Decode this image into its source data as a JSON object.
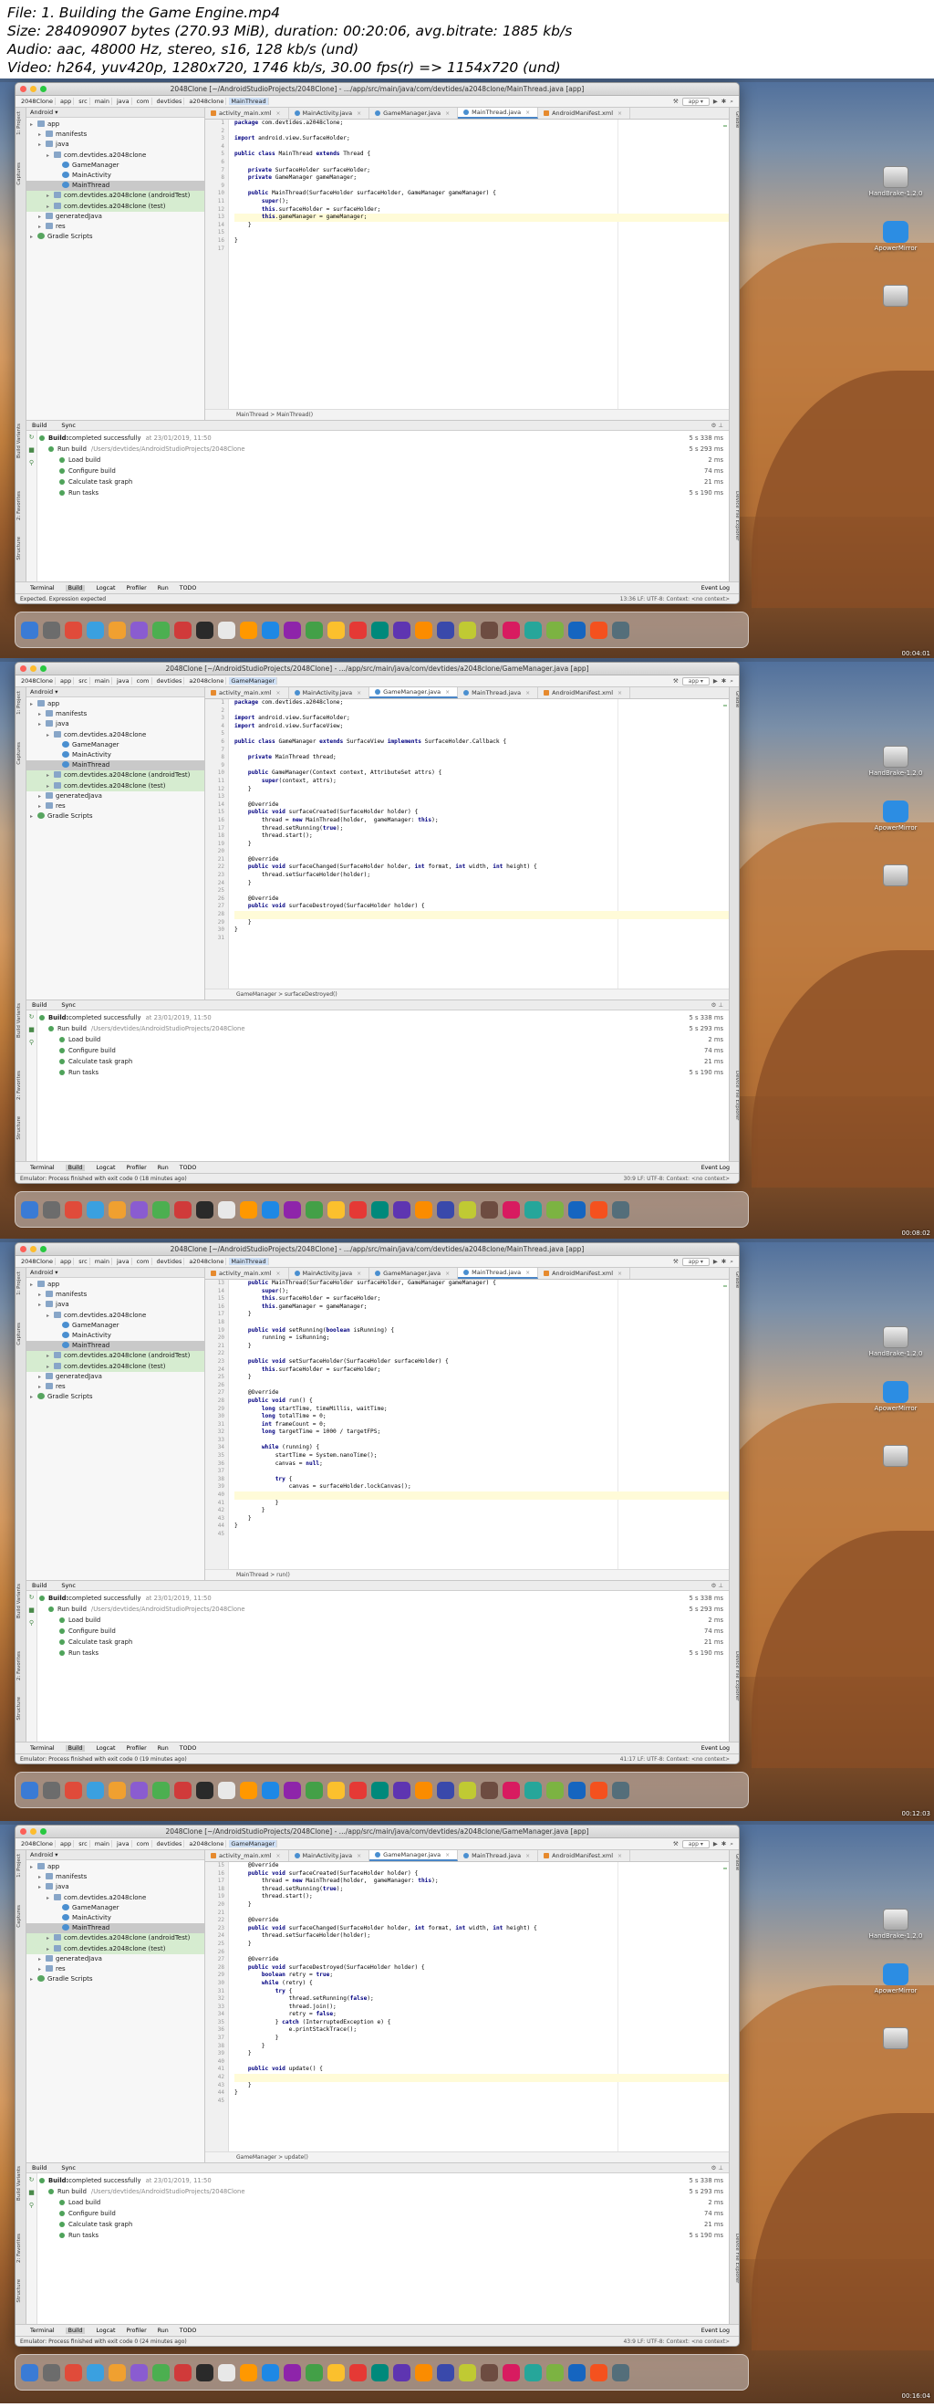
{
  "file_info": {
    "file": "File: 1. Building the Game Engine.mp4",
    "size": "Size: 284090907 bytes (270.93 MiB), duration: 00:20:06, avg.bitrate: 1885 kb/s",
    "audio": "Audio: aac, 48000 Hz, stereo, s16, 128 kb/s (und)",
    "video": "Video: h264, yuv420p, 1280x720, 1746 kb/s, 30.00 fps(r) => 1154x720 (und)"
  },
  "desktop": {
    "handbrake": "HandBrake-1.2.0",
    "apowermirror": "ApowerMirror"
  },
  "build": {
    "tab_build": "Build",
    "tab_sync": "Sync",
    "rows": [
      {
        "label": "Build:",
        "text": "completed successfully",
        "extra": "at 23/01/2019, 11:50",
        "time": "5 s 338 ms"
      },
      {
        "label": "Run build",
        "text": "",
        "extra": "/Users/devtides/AndroidStudioProjects/2048Clone",
        "time": "5 s 293 ms"
      },
      {
        "label": "Load build",
        "text": "",
        "extra": "",
        "time": "2 ms"
      },
      {
        "label": "Configure build",
        "text": "",
        "extra": "",
        "time": "74 ms"
      },
      {
        "label": "Calculate task graph",
        "text": "",
        "extra": "",
        "time": "21 ms"
      },
      {
        "label": "Run tasks",
        "text": "",
        "extra": "",
        "time": "5 s 190 ms"
      }
    ]
  },
  "toolwindows": {
    "terminal": "Terminal",
    "build": "Build",
    "logcat": "Logcat",
    "profiler": "Profiler",
    "run": "Run",
    "todo": "TODO",
    "eventlog": "Event Log"
  },
  "side_tabs": {
    "project": "1: Project",
    "captures": "Captures",
    "build_variants": "Build Variants",
    "favorites": "2: Favorites",
    "structure": "Structure",
    "gradle": "Gradle",
    "device_explorer": "Device File Explorer"
  },
  "tree_header": "Android",
  "tree": [
    {
      "label": "app",
      "indent": 0,
      "kind": "folder",
      "style": ""
    },
    {
      "label": "manifests",
      "indent": 1,
      "kind": "folder",
      "style": ""
    },
    {
      "label": "java",
      "indent": 1,
      "kind": "folder",
      "style": ""
    },
    {
      "label": "com.devtides.a2048clone",
      "indent": 2,
      "kind": "folder",
      "style": ""
    },
    {
      "label": "GameManager",
      "indent": 3,
      "kind": "cls",
      "style": ""
    },
    {
      "label": "MainActivity",
      "indent": 3,
      "kind": "cls",
      "style": ""
    },
    {
      "label": "MainThread",
      "indent": 3,
      "kind": "cls",
      "style": "sel"
    },
    {
      "label": "com.devtides.a2048clone (androidTest)",
      "indent": 2,
      "kind": "folder",
      "style": "green"
    },
    {
      "label": "com.devtides.a2048clone (test)",
      "indent": 2,
      "kind": "folder",
      "style": "green"
    },
    {
      "label": "generatedJava",
      "indent": 1,
      "kind": "folder",
      "style": ""
    },
    {
      "label": "res",
      "indent": 1,
      "kind": "folder",
      "style": ""
    },
    {
      "label": "Gradle Scripts",
      "indent": 0,
      "kind": "grd",
      "style": ""
    }
  ],
  "frames": [
    {
      "title": "2048Clone [~/AndroidStudioProjects/2048Clone] - .../app/src/main/java/com/devtides/a2048clone/MainThread.java [app]",
      "crumbs": [
        "2048Clone",
        "app",
        "src",
        "main",
        "java",
        "com",
        "devtides",
        "a2048clone",
        "MainThread"
      ],
      "tabs": [
        "activity_main.xml",
        "MainActivity.java",
        "GameManager.java",
        "MainThread.java",
        "AndroidManifest.xml"
      ],
      "active_tab": 3,
      "line_start": 1,
      "code": [
        "package com.devtides.a2048clone;",
        "",
        "import android.view.SurfaceHolder;",
        "",
        "public class MainThread extends Thread {",
        "",
        "    private SurfaceHolder surfaceHolder;",
        "    private GameManager gameManager;",
        "",
        "    public MainThread(SurfaceHolder surfaceHolder, GameManager gameManager) {",
        "        super();",
        "        this.surfaceHolder = surfaceHolder;",
        "        this.gameManager = gameManager;",
        "    }",
        "",
        "}",
        ""
      ],
      "highlight": 12,
      "code_crumb": "MainThread  >  MainThread()",
      "status": "Expected. Expression expected",
      "position": "13:36   LF:   UTF-8:   Context: <no context>"
    },
    {
      "title": "2048Clone [~/AndroidStudioProjects/2048Clone] - .../app/src/main/java/com/devtides/a2048clone/GameManager.java [app]",
      "crumbs": [
        "2048Clone",
        "app",
        "src",
        "main",
        "java",
        "com",
        "devtides",
        "a2048clone",
        "GameManager"
      ],
      "tabs": [
        "activity_main.xml",
        "MainActivity.java",
        "GameManager.java",
        "MainThread.java",
        "AndroidManifest.xml"
      ],
      "active_tab": 2,
      "line_start": 1,
      "code": [
        "package com.devtides.a2048clone;",
        "",
        "import android.view.SurfaceHolder;",
        "import android.view.SurfaceView;",
        "",
        "public class GameManager extends SurfaceView implements SurfaceHolder.Callback {",
        "",
        "    private MainThread thread;",
        "",
        "    public GameManager(Context context, AttributeSet attrs) {",
        "        super(context, attrs);",
        "    }",
        "",
        "    @Override",
        "    public void surfaceCreated(SurfaceHolder holder) {",
        "        thread = new MainThread(holder,  gameManager: this);",
        "        thread.setRunning(true);",
        "        thread.start();",
        "    }",
        "",
        "    @Override",
        "    public void surfaceChanged(SurfaceHolder holder, int format, int width, int height) {",
        "        thread.setSurfaceHolder(holder);",
        "    }",
        "",
        "    @Override",
        "    public void surfaceDestroyed(SurfaceHolder holder) {",
        "",
        "    }",
        "}",
        ""
      ],
      "highlight": 27,
      "code_crumb": "GameManager  >  surfaceDestroyed()",
      "status": "Emulator: Process finished with exit code 0 (18 minutes ago)",
      "position": "30:9   LF:   UTF-8:   Context: <no context>"
    },
    {
      "title": "2048Clone [~/AndroidStudioProjects/2048Clone] - .../app/src/main/java/com/devtides/a2048clone/MainThread.java [app]",
      "crumbs": [
        "2048Clone",
        "app",
        "src",
        "main",
        "java",
        "com",
        "devtides",
        "a2048clone",
        "MainThread"
      ],
      "tabs": [
        "activity_main.xml",
        "MainActivity.java",
        "GameManager.java",
        "MainThread.java",
        "AndroidManifest.xml"
      ],
      "active_tab": 3,
      "line_start": 13,
      "code": [
        "    public MainThread(SurfaceHolder surfaceHolder, GameManager gameManager) {",
        "        super();",
        "        this.surfaceHolder = surfaceHolder;",
        "        this.gameManager = gameManager;",
        "    }",
        "",
        "    public void setRunning(boolean isRunning) {",
        "        running = isRunning;",
        "    }",
        "",
        "    public void setSurfaceHolder(SurfaceHolder surfaceHolder) {",
        "        this.surfaceHolder = surfaceHolder;",
        "    }",
        "",
        "    @Override",
        "    public void run() {",
        "        long startTime, timeMillis, waitTime;",
        "        long totalTime = 0;",
        "        int frameCount = 0;",
        "        long targetTime = 1000 / targetFPS;",
        "",
        "        while (running) {",
        "            startTime = System.nanoTime();",
        "            canvas = null;",
        "",
        "            try {",
        "                canvas = surfaceHolder.lockCanvas();",
        "",
        "            }",
        "        }",
        "    }",
        "}",
        ""
      ],
      "highlight": 27,
      "code_crumb": "MainThread  >  run()",
      "status": "Emulator: Process finished with exit code 0 (19 minutes ago)",
      "position": "41:17   LF:   UTF-8:   Context: <no context>"
    },
    {
      "title": "2048Clone [~/AndroidStudioProjects/2048Clone] - .../app/src/main/java/com/devtides/a2048clone/GameManager.java [app]",
      "crumbs": [
        "2048Clone",
        "app",
        "src",
        "main",
        "java",
        "com",
        "devtides",
        "a2048clone",
        "GameManager"
      ],
      "tabs": [
        "activity_main.xml",
        "MainActivity.java",
        "GameManager.java",
        "MainThread.java",
        "AndroidManifest.xml"
      ],
      "active_tab": 2,
      "line_start": 15,
      "code": [
        "    @Override",
        "    public void surfaceCreated(SurfaceHolder holder) {",
        "        thread = new MainThread(holder,  gameManager: this);",
        "        thread.setRunning(true);",
        "        thread.start();",
        "    }",
        "",
        "    @Override",
        "    public void surfaceChanged(SurfaceHolder holder, int format, int width, int height) {",
        "        thread.setSurfaceHolder(holder);",
        "    }",
        "",
        "    @Override",
        "    public void surfaceDestroyed(SurfaceHolder holder) {",
        "        boolean retry = true;",
        "        while (retry) {",
        "            try {",
        "                thread.setRunning(false);",
        "                thread.join();",
        "                retry = false;",
        "            } catch (InterruptedException e) {",
        "                e.printStackTrace();",
        "            }",
        "        }",
        "    }",
        "",
        "    public void update() {",
        "",
        "    }",
        "}",
        ""
      ],
      "highlight": 27,
      "code_crumb": "GameManager  >  update()",
      "status": "Emulator: Process finished with exit code 0 (24 minutes ago)",
      "position": "43:9   LF:   UTF-8:   Context: <no context>"
    }
  ],
  "timestamps": [
    "00:04:01",
    "00:08:02",
    "00:12:03",
    "00:16:04"
  ]
}
